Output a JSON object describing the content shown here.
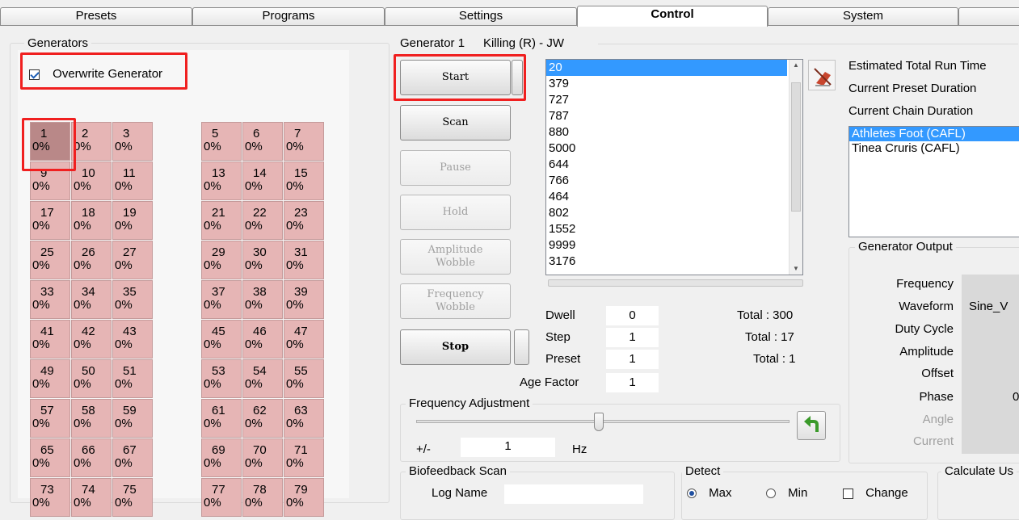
{
  "tabs": [
    "Presets",
    "Programs",
    "Settings",
    "Control",
    "System"
  ],
  "generators_panel": {
    "title": "Generators",
    "overwrite_label": "Overwrite Generator",
    "left_columns": [
      1,
      2,
      3
    ],
    "right_columns": [
      5,
      6,
      7
    ],
    "rows": [
      [
        "1",
        "2",
        "3",
        "5",
        "6",
        "7"
      ],
      [
        "9",
        "10",
        "11",
        "13",
        "14",
        "15"
      ],
      [
        "17",
        "18",
        "19",
        "21",
        "22",
        "23"
      ],
      [
        "25",
        "26",
        "27",
        "29",
        "30",
        "31"
      ],
      [
        "33",
        "34",
        "35",
        "37",
        "38",
        "39"
      ],
      [
        "41",
        "42",
        "43",
        "45",
        "46",
        "47"
      ],
      [
        "49",
        "50",
        "51",
        "53",
        "54",
        "55"
      ],
      [
        "57",
        "58",
        "59",
        "61",
        "62",
        "63"
      ],
      [
        "65",
        "66",
        "67",
        "69",
        "70",
        "71"
      ],
      [
        "73",
        "74",
        "75",
        "77",
        "78",
        "79"
      ]
    ],
    "percent": "0%"
  },
  "generator": {
    "title": "Generator 1",
    "preset_name": "Killing (R) - JW",
    "buttons": {
      "start": "Start",
      "scan": "Scan",
      "pause": "Pause",
      "hold": "Hold",
      "amplitude_wobble": "Amplitude\nWobble",
      "frequency_wobble": "Frequency\nWobble",
      "stop": "Stop"
    },
    "frequencies": [
      "20",
      "379",
      "727",
      "787",
      "880",
      "5000",
      "644",
      "766",
      "464",
      "802",
      "1552",
      "9999",
      "3176"
    ],
    "dwell_label": "Dwell",
    "dwell_value": "0",
    "dwell_total": "Total : 300",
    "step_label": "Step",
    "step_value": "1",
    "step_total": "Total : 17",
    "preset_label": "Preset",
    "preset_value": "1",
    "preset_total": "Total : 1",
    "age_label": "Age Factor",
    "age_value": "1"
  },
  "run_info": {
    "est_total": "Estimated Total Run Time",
    "cur_preset": "Current Preset Duration",
    "cur_chain": "Current Chain Duration",
    "chain_items": [
      "Athletes Foot (CAFL)",
      "Tinea Cruris (CAFL)"
    ]
  },
  "output": {
    "title": "Generator Output",
    "labels": [
      "Frequency",
      "Waveform",
      "Duty Cycle",
      "Amplitude",
      "Offset",
      "Phase",
      "Angle",
      "Current"
    ],
    "waveform_value": "Sine_V",
    "phase_value": "0"
  },
  "freq_adjust": {
    "title": "Frequency Adjustment",
    "pm_label": "+/-",
    "value": "1",
    "unit": "Hz",
    "slider_position": 0.49
  },
  "biofeedback": {
    "title": "Biofeedback Scan",
    "log_name_label": "Log Name",
    "log_name_value": ""
  },
  "detect": {
    "title": "Detect",
    "max_label": "Max",
    "min_label": "Min",
    "change_label": "Change"
  },
  "calculate": {
    "title": "Calculate Us"
  }
}
